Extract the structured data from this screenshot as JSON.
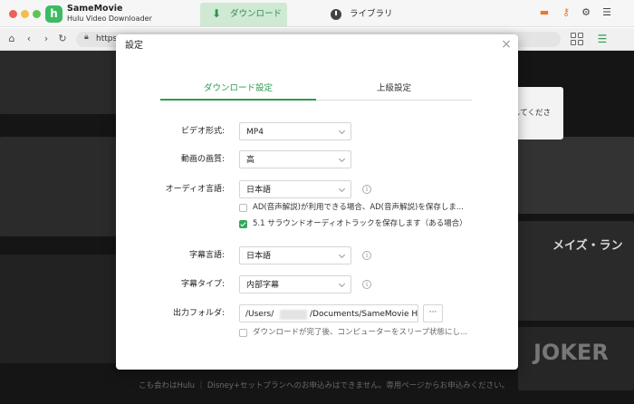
{
  "app": {
    "name": "SameMovie",
    "subtitle": "Hulu Video Downloader",
    "logo_letter": "h"
  },
  "nav": {
    "download_tab": "ダウンロード",
    "library_tab": "ライブラリ"
  },
  "toolbar_icons": [
    "cart-icon",
    "key-icon",
    "gear-icon",
    "menu-icon"
  ],
  "browser": {
    "url": "https"
  },
  "background": {
    "tooltip_text": "してくださ",
    "side_text": "メイズ・ラン",
    "poster_title": "JOKER",
    "bottom_notice": "こも会わはHulu ｜ Disney+セットプランへのお申込みはできません。専用ページからお申込みください。"
  },
  "dialog": {
    "title": "設定",
    "tabs": {
      "download": "ダウンロード設定",
      "advanced": "上級設定"
    },
    "video_format": {
      "label": "ビデオ形式:",
      "value": "MP4"
    },
    "video_quality": {
      "label": "動画の画質:",
      "value": "高"
    },
    "audio_language": {
      "label": "オーディオ言語:",
      "value": "日本語"
    },
    "audio_options": {
      "ad_option": {
        "label": "AD(音声解説)が利用できる場合、AD(音声解説)を保存しま...",
        "checked": false
      },
      "surround_option": {
        "label": "5.1 サラウンドオーディオトラックを保存します（ある場合）",
        "checked": true
      }
    },
    "subtitle_language": {
      "label": "字幕言語:",
      "value": "日本語"
    },
    "subtitle_type": {
      "label": "字幕タイプ:",
      "value": "内部字幕"
    },
    "output_folder": {
      "label": "出力フォルダ:",
      "path_start": "/Users/",
      "path_end": "/Documents/SameMovie Hulu",
      "browse_label": "···"
    },
    "sleep_option": {
      "label": "ダウンロードが完了後、コンピューターをスリープ状態にし...",
      "checked": false
    },
    "info_glyph": "i"
  },
  "colors": {
    "accent": "#2e9a4f",
    "checkbox_checked": "#34a85a",
    "download_tab_bg": "#cfe9d4"
  }
}
